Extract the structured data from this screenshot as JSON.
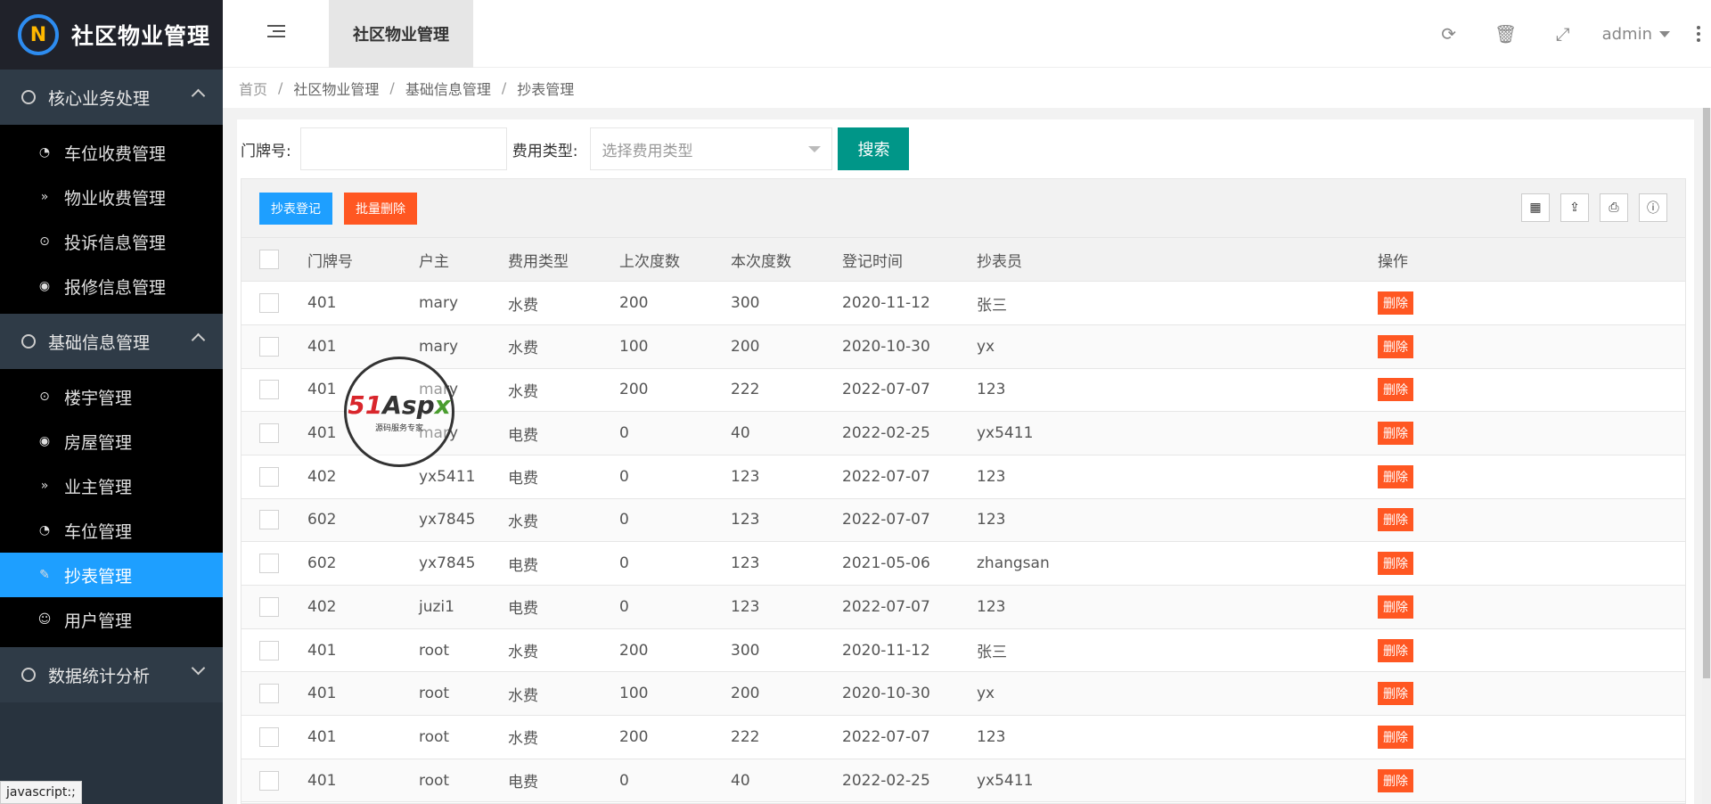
{
  "app": {
    "title": "社区物业管理",
    "logo_letter": "N"
  },
  "sidebar": {
    "groups": [
      {
        "label": "核心业务处理",
        "expanded": true,
        "items": [
          {
            "label": "车位收费管理",
            "icon": "dashboard-icon",
            "glyph": "◔"
          },
          {
            "label": "物业收费管理",
            "icon": "double-chevron-icon",
            "glyph": "»"
          },
          {
            "label": "投诉信息管理",
            "icon": "target-icon",
            "glyph": "⊙"
          },
          {
            "label": "报修信息管理",
            "icon": "circle-up-icon",
            "glyph": "◉"
          }
        ]
      },
      {
        "label": "基础信息管理",
        "expanded": true,
        "items": [
          {
            "label": "楼宇管理",
            "icon": "target-icon",
            "glyph": "⊙"
          },
          {
            "label": "房屋管理",
            "icon": "circle-up-icon",
            "glyph": "◉"
          },
          {
            "label": "业主管理",
            "icon": "double-chevron-icon",
            "glyph": "»"
          },
          {
            "label": "车位管理",
            "icon": "dashboard-icon",
            "glyph": "◔"
          },
          {
            "label": "抄表管理",
            "icon": "edit-icon",
            "glyph": "✎",
            "active": true
          },
          {
            "label": "用户管理",
            "icon": "user-icon",
            "glyph": "☺"
          }
        ]
      },
      {
        "label": "数据统计分析",
        "expanded": false,
        "items": []
      }
    ]
  },
  "header": {
    "tab_label": "社区物业管理",
    "user": "admin",
    "refresh_glyph": "⟳",
    "trash_glyph": "🗑",
    "fullscreen_glyph": "⤢"
  },
  "breadcrumb": [
    "首页",
    "社区物业管理",
    "基础信息管理",
    "抄表管理"
  ],
  "search": {
    "door_label": "门牌号:",
    "door_value": "",
    "fee_label": "费用类型:",
    "fee_placeholder": "选择费用类型",
    "search_button": "搜索"
  },
  "toolbar": {
    "add_button": "抄表登记",
    "batch_delete_button": "批量删除",
    "columns_glyph": "▦",
    "export_glyph": "⇪",
    "print_glyph": "⎙",
    "info_glyph": "ⓘ"
  },
  "table": {
    "headers": [
      "门牌号",
      "户主",
      "费用类型",
      "上次度数",
      "本次度数",
      "登记时间",
      "抄表员",
      "操作"
    ],
    "delete_label": "删除",
    "rows": [
      [
        "401",
        "mary",
        "水费",
        "200",
        "300",
        "2020-11-12",
        "张三"
      ],
      [
        "401",
        "mary",
        "水费",
        "100",
        "200",
        "2020-10-30",
        "yx"
      ],
      [
        "401",
        "mary",
        "水费",
        "200",
        "222",
        "2022-07-07",
        "123"
      ],
      [
        "401",
        "mary",
        "电费",
        "0",
        "40",
        "2022-02-25",
        "yx5411"
      ],
      [
        "402",
        "yx5411",
        "电费",
        "0",
        "123",
        "2022-07-07",
        "123"
      ],
      [
        "602",
        "yx7845",
        "水费",
        "0",
        "123",
        "2022-07-07",
        "123"
      ],
      [
        "602",
        "yx7845",
        "电费",
        "0",
        "123",
        "2021-05-06",
        "zhangsan"
      ],
      [
        "402",
        "juzi1",
        "电费",
        "0",
        "123",
        "2022-07-07",
        "123"
      ],
      [
        "401",
        "root",
        "水费",
        "200",
        "300",
        "2020-11-12",
        "张三"
      ],
      [
        "401",
        "root",
        "水费",
        "100",
        "200",
        "2020-10-30",
        "yx"
      ],
      [
        "401",
        "root",
        "水费",
        "200",
        "222",
        "2022-07-07",
        "123"
      ],
      [
        "401",
        "root",
        "电费",
        "0",
        "40",
        "2022-02-25",
        "yx5411"
      ]
    ]
  },
  "watermark": {
    "main_a": "51",
    "main_b": "Asp",
    "main_c": "x",
    "sub": "源码服务专家"
  },
  "statusbar": "javascript:;",
  "colors": {
    "sidebar": "#28333e",
    "active": "#1e9fff",
    "danger": "#ff5722",
    "primary": "#009688"
  }
}
